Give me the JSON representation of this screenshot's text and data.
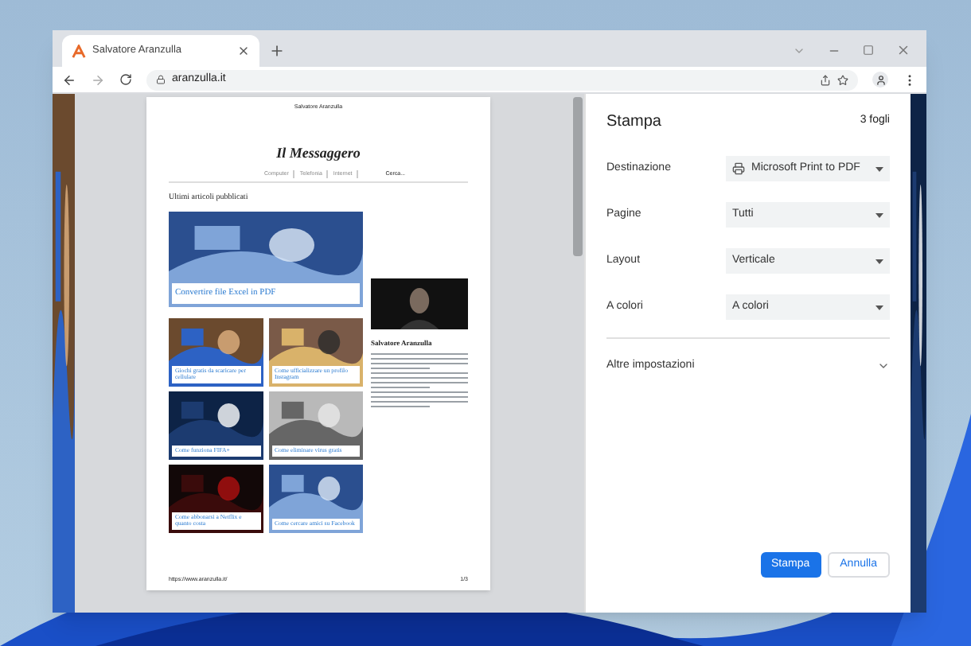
{
  "browser": {
    "tab_title": "Salvatore Aranzulla",
    "address": "aranzulla.it"
  },
  "preview": {
    "header_center": "Salvatore Aranzulla",
    "logo": "Il Messaggero",
    "nav": [
      "Computer",
      "Telefonia",
      "Internet"
    ],
    "search": "Cerca...",
    "section_title": "Ultimi articoli pubblicati",
    "featured": "Convertire file Excel in PDF",
    "articles": [
      "Giochi gratis da scaricare per cellulare",
      "Come ufficializzare un profilo Instagram",
      "Come funziona FIFA+",
      "Come eliminare virus gratis",
      "Come abbonarsi a Netflix e quanto costa",
      "Come cercare amici su Facebook"
    ],
    "author_name": "Salvatore Aranzulla",
    "footer_url": "https://www.aranzulla.it/",
    "page_number": "1/3"
  },
  "print": {
    "title": "Stampa",
    "sheets": "3 fogli",
    "settings": [
      {
        "label": "Destinazione",
        "value": "Microsoft Print to PDF",
        "kind": "printer"
      },
      {
        "label": "Pagine",
        "value": "Tutti",
        "kind": "plain"
      },
      {
        "label": "Layout",
        "value": "Verticale",
        "kind": "plain"
      },
      {
        "label": "A colori",
        "value": "A colori",
        "kind": "plain"
      }
    ],
    "more": "Altre impostazioni",
    "expanded": false,
    "buttons": [
      {
        "label": "Stampa",
        "primary": true
      },
      {
        "label": "Annulla",
        "primary": false
      }
    ]
  }
}
